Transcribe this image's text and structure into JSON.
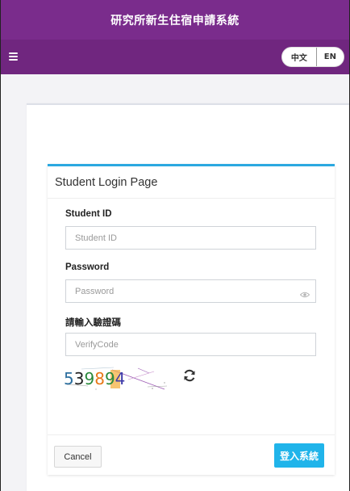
{
  "header": {
    "title": "研究所新生住宿申請系統"
  },
  "navbar": {
    "lang_zh": "中文",
    "lang_en": "EN"
  },
  "login": {
    "title": "Student Login Page",
    "student_id_label": "Student ID",
    "student_id_placeholder": "Student ID",
    "password_label": "Password",
    "password_placeholder": "Password",
    "verify_label": "請輸入驗證碼",
    "verify_placeholder": "VerifyCode",
    "captcha_text": "539894",
    "cancel_label": "Cancel",
    "submit_label": "登入系統"
  },
  "colors": {
    "header": "#7a2c8c",
    "navbar": "#70267f",
    "accent": "#2ba8e0",
    "button": "#20b4ea"
  },
  "icons": [
    "hamburger-icon",
    "eye-icon",
    "refresh-icon"
  ]
}
